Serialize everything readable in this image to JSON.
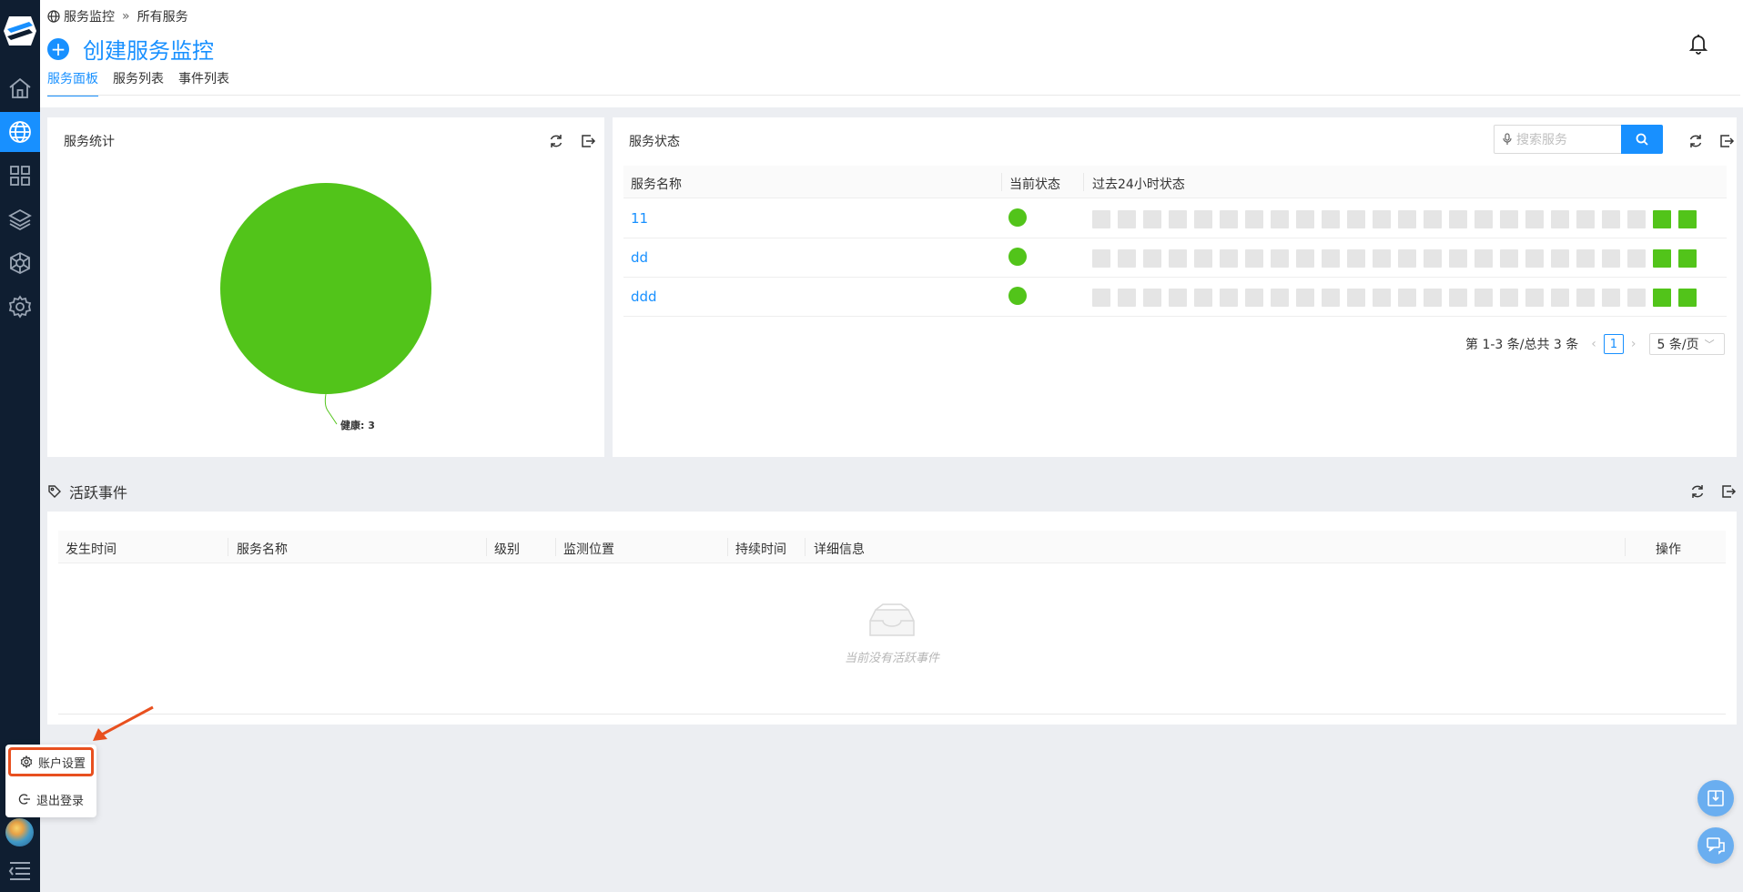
{
  "app": {
    "accent": "#1890ff",
    "success": "#52c41a",
    "sidebar_bg": "#0f1e31"
  },
  "sidebar": {
    "items": [
      {
        "icon": "home-icon"
      },
      {
        "icon": "globe-icon",
        "active": true
      },
      {
        "icon": "grid-icon"
      },
      {
        "icon": "layers-icon"
      },
      {
        "icon": "atom-icon"
      },
      {
        "icon": "gear-icon"
      }
    ]
  },
  "breadcrumb": {
    "root": "服务监控",
    "sep": "»",
    "current": "所有服务"
  },
  "header": {
    "title": "创建服务监控",
    "plus": "+"
  },
  "tabs": [
    {
      "label": "服务面板",
      "active": true
    },
    {
      "label": "服务列表"
    },
    {
      "label": "事件列表"
    }
  ],
  "stats_card": {
    "title": "服务统计",
    "slice_label": "健康: 3"
  },
  "chart_data": {
    "type": "pie",
    "categories": [
      "健康"
    ],
    "values": [
      3
    ],
    "colors": [
      "#52c41a"
    ]
  },
  "status_card": {
    "title": "服务状态",
    "search_placeholder": "搜索服务",
    "columns": {
      "name": "服务名称",
      "current": "当前状态",
      "history": "过去24小时状态"
    },
    "rows": [
      {
        "name": "11",
        "history": [
          0,
          0,
          0,
          0,
          0,
          0,
          0,
          0,
          0,
          0,
          0,
          0,
          0,
          0,
          0,
          0,
          0,
          0,
          0,
          0,
          0,
          0,
          1,
          1
        ]
      },
      {
        "name": "dd",
        "history": [
          0,
          0,
          0,
          0,
          0,
          0,
          0,
          0,
          0,
          0,
          0,
          0,
          0,
          0,
          0,
          0,
          0,
          0,
          0,
          0,
          0,
          0,
          1,
          1
        ]
      },
      {
        "name": "ddd",
        "history": [
          0,
          0,
          0,
          0,
          0,
          0,
          0,
          0,
          0,
          0,
          0,
          0,
          0,
          0,
          0,
          0,
          0,
          0,
          0,
          0,
          0,
          0,
          1,
          1
        ]
      }
    ],
    "pagination": {
      "summary": "第 1-3 条/总共 3 条",
      "page": "1",
      "page_size": "5 条/页"
    }
  },
  "events_card": {
    "title": "活跃事件",
    "columns": {
      "time": "发生时间",
      "name": "服务名称",
      "level": "级别",
      "location": "监测位置",
      "duration": "持续时间",
      "detail": "详细信息",
      "action": "操作"
    },
    "empty_text": "当前没有活跃事件"
  },
  "popup_menu": {
    "account_settings": "账户设置",
    "logout": "退出登录"
  }
}
